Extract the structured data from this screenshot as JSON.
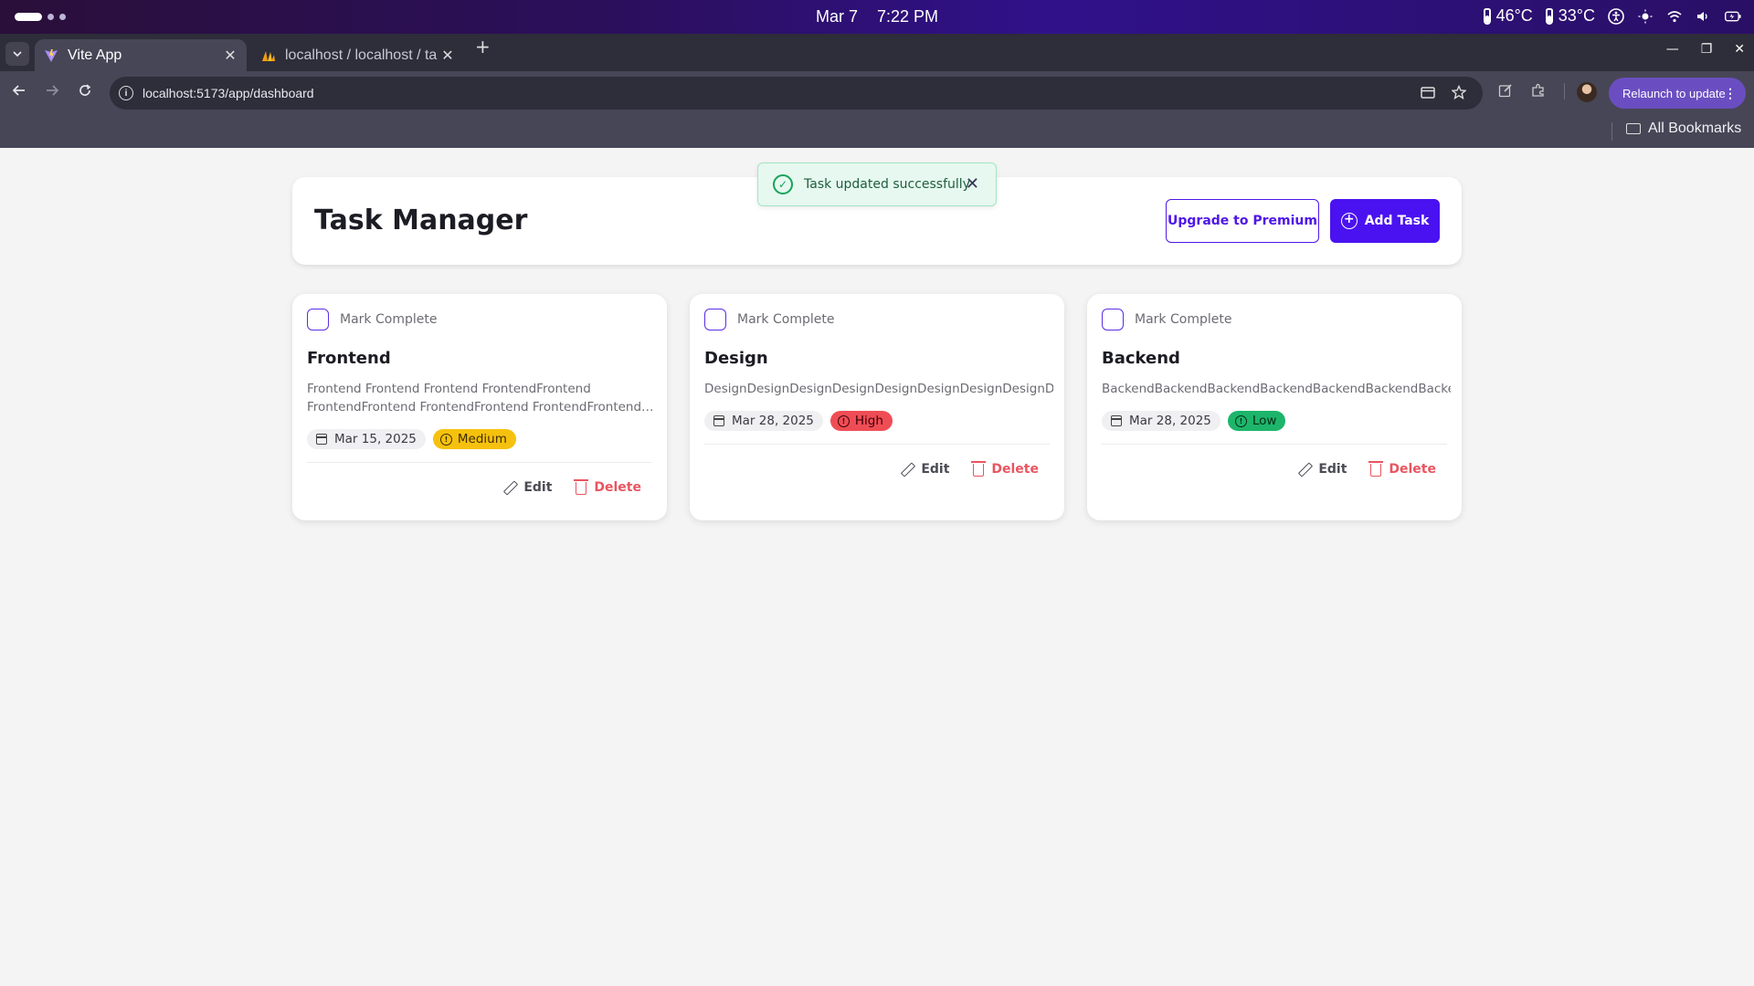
{
  "os": {
    "date": "Mar 7",
    "time": "7:22 PM",
    "temp1": "46°C",
    "temp2": "33°C",
    "icons": [
      "accessibility-icon",
      "brightness-icon",
      "wifi-icon",
      "volume-icon",
      "battery-icon"
    ]
  },
  "browser": {
    "tabs": [
      {
        "title": "Vite App",
        "active": true,
        "icon": "vite-icon"
      },
      {
        "title": "localhost / localhost / ta",
        "active": false,
        "icon": "phpmyadmin-icon"
      }
    ],
    "url": "localhost:5173/app/dashboard",
    "relaunch_label": "Relaunch to update",
    "bookmarks_label": "All Bookmarks"
  },
  "toast": {
    "message": "Task updated successfully"
  },
  "header": {
    "title": "Task Manager",
    "upgrade_label": "Upgrade to Premium",
    "add_label": "Add Task"
  },
  "tasks": [
    {
      "mark_label": "Mark Complete",
      "title": "Frontend",
      "description": "Frontend Frontend Frontend FrontendFrontend FrontendFrontend FrontendFrontend FrontendFrontend…",
      "date": "Mar 15, 2025",
      "priority": "Medium",
      "priority_color": "#f6c10e",
      "edit_label": "Edit",
      "delete_label": "Delete"
    },
    {
      "mark_label": "Mark Complete",
      "title": "Design",
      "description": "DesignDesignDesignDesignDesignDesignDesignDesignDesig",
      "date": "Mar 28, 2025",
      "priority": "High",
      "priority_color": "#ef4d55",
      "edit_label": "Edit",
      "delete_label": "Delete"
    },
    {
      "mark_label": "Mark Complete",
      "title": "Backend",
      "description": "BackendBackendBackendBackendBackendBackendBackendB",
      "date": "Mar 28, 2025",
      "priority": "Low",
      "priority_color": "#1db56b",
      "edit_label": "Edit",
      "delete_label": "Delete"
    }
  ],
  "colors": {
    "accent": "#4a12f0",
    "success": "#17a35a",
    "danger": "#e85560"
  }
}
